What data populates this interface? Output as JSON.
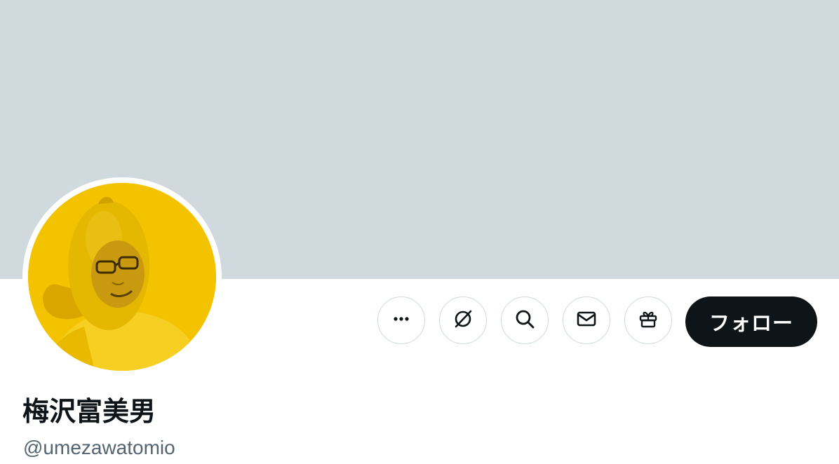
{
  "profile": {
    "display_name": "梅沢富美男",
    "handle": "@umezawatomio",
    "avatar_icon": "profile-photo-lemon-costume"
  },
  "actions": {
    "more_icon": "more-icon",
    "grok_icon": "grok-icon",
    "search_icon": "search-icon",
    "message_icon": "mail-icon",
    "gift_icon": "gift-icon",
    "follow_label": "フォロー"
  },
  "colors": {
    "banner": "#cfd9de",
    "follow_button_bg": "#0f1419",
    "handle_text": "#536471",
    "avatar_bg": "#f2c300"
  }
}
